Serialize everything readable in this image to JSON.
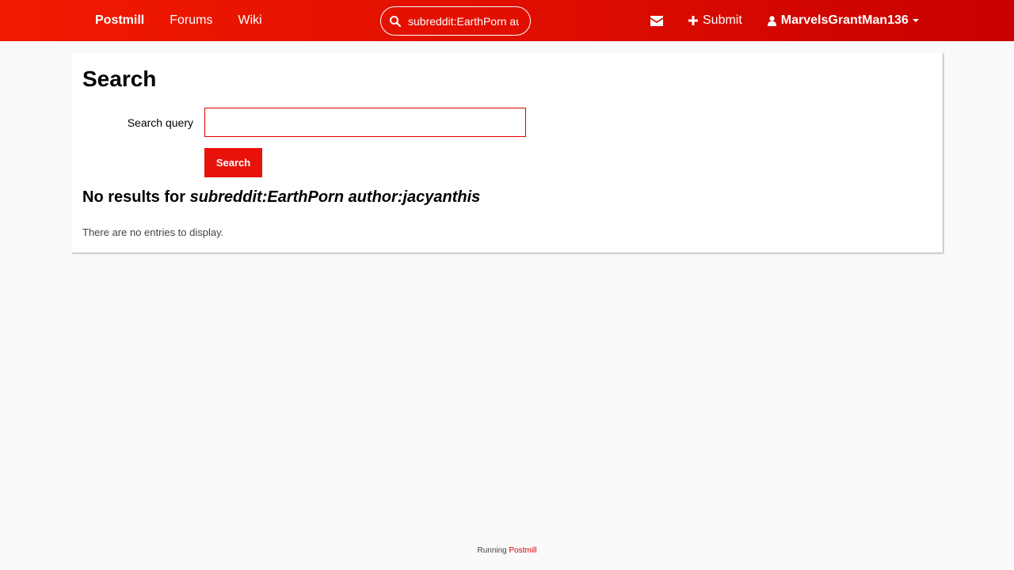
{
  "header": {
    "brand": "Postmill",
    "nav": [
      {
        "label": "Forums"
      },
      {
        "label": "Wiki"
      }
    ],
    "search": {
      "value": "subreddit:EarthPorn author:jacyanthis",
      "icon": "search-icon"
    },
    "messages_icon": "envelope-icon",
    "submit_label": "Submit",
    "submit_icon": "plus-icon",
    "user": {
      "name": "MarvelsGrantMan136",
      "icon": "user-icon"
    }
  },
  "main": {
    "title": "Search",
    "query_label": "Search query",
    "query_value": "",
    "search_button": "Search",
    "results_prefix": "No results for ",
    "results_query": "subreddit:EarthPorn author:jacyanthis",
    "empty_message": "There are no entries to display."
  },
  "footer": {
    "prefix": "Running ",
    "link": "Postmill"
  },
  "colors": {
    "header_start": "#f21a00",
    "header_end": "#c80000",
    "accent": "#e8120b"
  }
}
